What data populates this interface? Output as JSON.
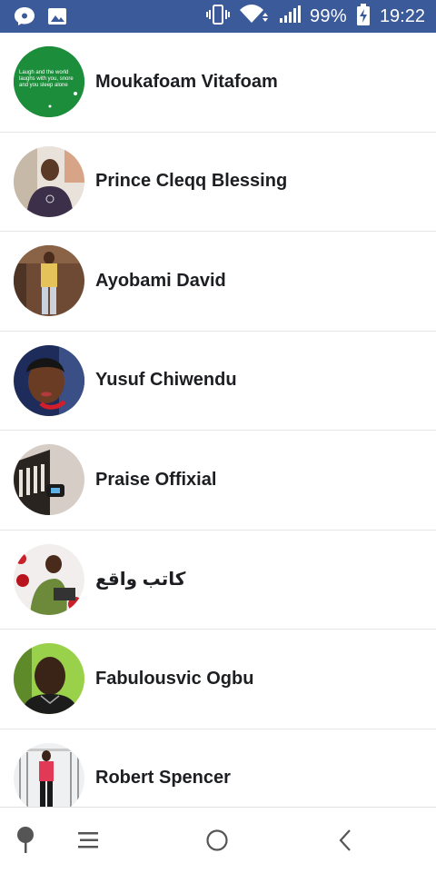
{
  "status_bar": {
    "battery_percent": "99%",
    "time": "19:22",
    "icons": [
      "messenger-icon",
      "image-icon",
      "vibrate-icon",
      "wifi-icon",
      "signal-icon",
      "battery-charging-icon"
    ]
  },
  "contacts": [
    {
      "name": "Moukafoam Vitafoam",
      "avatar_text": "Laugh and the world laughs with you, snore and you sleep alone"
    },
    {
      "name": "Prince Cleqq Blessing"
    },
    {
      "name": "Ayobami David"
    },
    {
      "name": "Yusuf Chiwendu"
    },
    {
      "name": "Praise Offixial"
    },
    {
      "name": "كاتب واقع"
    },
    {
      "name": "Fabulousvic Ogbu"
    },
    {
      "name": "Robert Spencer"
    }
  ],
  "nav_bar": {
    "icons": [
      "pin-icon",
      "menu-icon",
      "home-icon",
      "back-icon"
    ]
  }
}
